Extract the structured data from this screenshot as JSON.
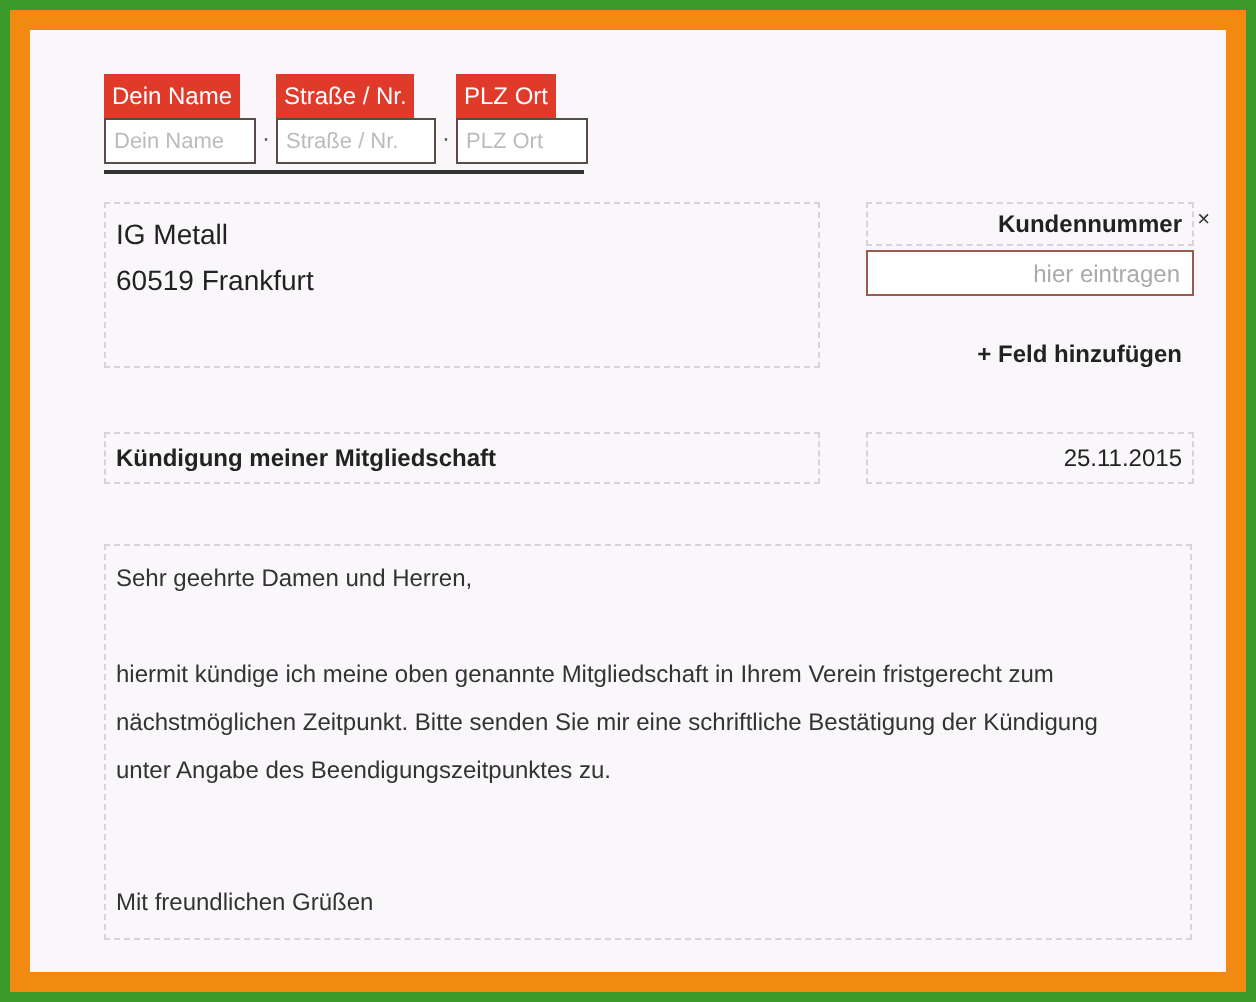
{
  "sender_fields": [
    {
      "label": "Dein Name",
      "placeholder": "Dein Name"
    },
    {
      "label": "Straße / Nr.",
      "placeholder": "Straße / Nr."
    },
    {
      "label": "PLZ Ort",
      "placeholder": "PLZ Ort"
    }
  ],
  "separator": "·",
  "recipient": [
    "IG Metall",
    "60519 Frankfurt"
  ],
  "customer_number": {
    "label": "Kundennummer",
    "placeholder": "hier eintragen",
    "remove": "×"
  },
  "add_field": "+ Feld hinzufügen",
  "subject": "Kündigung meiner Mitgliedschaft",
  "date": "25.11.2015",
  "body": {
    "greeting": "Sehr geehrte Damen und Herren,",
    "paragraph": "hiermit kündige ich meine oben genannte Mitgliedschaft in Ihrem Verein fristgerecht zum nächstmöglichen Zeitpunkt. Bitte senden Sie mir eine schriftliche Bestätigung der Kündigung unter Angabe des Beendigungszeitpunktes zu.",
    "closing": "Mit freundlichen Grüßen"
  }
}
